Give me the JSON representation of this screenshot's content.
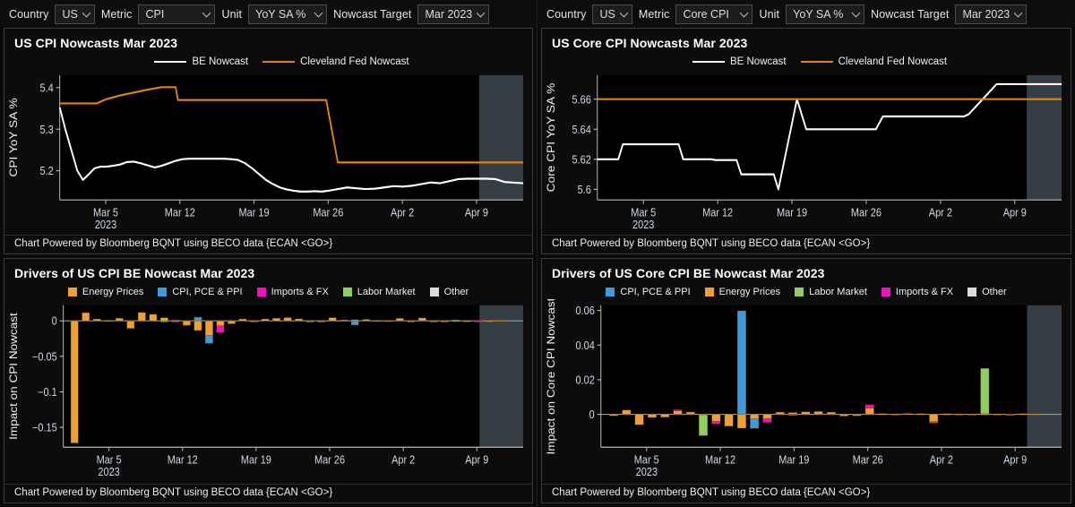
{
  "panels": {
    "topleft": {
      "controls": {
        "country_label": "Country",
        "country_value": "US",
        "metric_label": "Metric",
        "metric_value": "CPI",
        "unit_label": "Unit",
        "unit_value": "YoY SA %",
        "target_label": "Nowcast Target",
        "target_value": "Mar 2023"
      },
      "title": "US CPI Nowcasts Mar 2023",
      "footer": "Chart Powered by Bloomberg BQNT using BECO data {ECAN <GO>}"
    },
    "topright": {
      "controls": {
        "country_label": "Country",
        "country_value": "US",
        "metric_label": "Metric",
        "metric_value": "Core CPI",
        "unit_label": "Unit",
        "unit_value": "YoY SA %",
        "target_label": "Nowcast Target",
        "target_value": "Mar 2023"
      },
      "title": "US Core CPI Nowcasts Mar 2023",
      "footer": "Chart Powered by Bloomberg BQNT using BECO data {ECAN <GO>}"
    },
    "botleft": {
      "title": "Drivers of US CPI BE Nowcast Mar 2023",
      "footer": "Chart Powered by Bloomberg BQNT using BECO data {ECAN <GO>}"
    },
    "botright": {
      "title": "Drivers of US Core CPI BE Nowcast Mar 2023",
      "footer": "Chart Powered by Bloomberg BQNT using BECO data {ECAN <GO>}"
    }
  },
  "colors": {
    "be_nowcast": "#ffffff",
    "cleveland": "#e08214",
    "energy": "#f0a030",
    "cpi_pce_ppi": "#3d9ae0",
    "imports_fx": "#f012be",
    "labor_market": "#8ed060",
    "other": "#dcdcdc",
    "shade": "#3a434a",
    "panel_border": "#3b3b3b"
  },
  "chart_data": [
    {
      "id": "us-cpi-nowcasts",
      "type": "line",
      "title": "US CPI Nowcasts Mar 2023",
      "xlabel": "",
      "ylabel": "CPI YoY SA %",
      "ylim": [
        5.13,
        5.43
      ],
      "yticks": [
        5.2,
        5.3,
        5.4
      ],
      "ytick_labels": [
        "5.2",
        "5.3",
        "5.4"
      ],
      "xticks": [
        "Mar 5",
        "Mar 12",
        "Mar 19",
        "Mar 26",
        "Apr 2",
        "Apr 9"
      ],
      "x_sublabel": "2023",
      "legend": [
        "BE Nowcast",
        "Cleveland Fed Nowcast"
      ],
      "legend_position": "top-center",
      "grid": false,
      "shaded_region_from": 0.905,
      "series": [
        {
          "name": "BE Nowcast",
          "color": "#ffffff",
          "x": [
            0,
            0.012,
            0.025,
            0.038,
            0.05,
            0.063,
            0.075,
            0.088,
            0.1,
            0.115,
            0.13,
            0.145,
            0.16,
            0.175,
            0.19,
            0.205,
            0.22,
            0.235,
            0.25,
            0.265,
            0.28,
            0.295,
            0.31,
            0.325,
            0.34,
            0.355,
            0.37,
            0.385,
            0.4,
            0.415,
            0.43,
            0.445,
            0.46,
            0.475,
            0.49,
            0.505,
            0.52,
            0.535,
            0.55,
            0.565,
            0.58,
            0.6,
            0.62,
            0.64,
            0.66,
            0.68,
            0.7,
            0.72,
            0.74,
            0.76,
            0.78,
            0.8,
            0.82,
            0.84,
            0.86,
            0.88,
            0.9,
            0.92,
            0.94,
            0.96,
            1.0
          ],
          "values": [
            5.352,
            5.3,
            5.25,
            5.2,
            5.178,
            5.192,
            5.206,
            5.21,
            5.21,
            5.212,
            5.215,
            5.221,
            5.222,
            5.218,
            5.213,
            5.208,
            5.212,
            5.218,
            5.224,
            5.228,
            5.229,
            5.229,
            5.229,
            5.229,
            5.229,
            5.229,
            5.228,
            5.226,
            5.218,
            5.206,
            5.192,
            5.178,
            5.168,
            5.16,
            5.155,
            5.152,
            5.15,
            5.15,
            5.151,
            5.15,
            5.152,
            5.156,
            5.16,
            5.158,
            5.156,
            5.157,
            5.16,
            5.163,
            5.162,
            5.164,
            5.168,
            5.172,
            5.17,
            5.175,
            5.18,
            5.181,
            5.181,
            5.181,
            5.18,
            5.173,
            5.17
          ]
        },
        {
          "name": "Cleveland Fed Nowcast",
          "color": "#e08214",
          "x": [
            0,
            0.04,
            0.08,
            0.1,
            0.13,
            0.16,
            0.19,
            0.22,
            0.25,
            0.255,
            0.3,
            0.4,
            0.5,
            0.55,
            0.575,
            0.6,
            0.7,
            0.8,
            0.9,
            1.0
          ],
          "values": [
            5.362,
            5.362,
            5.362,
            5.372,
            5.381,
            5.388,
            5.395,
            5.401,
            5.401,
            5.37,
            5.37,
            5.37,
            5.37,
            5.37,
            5.37,
            5.22,
            5.22,
            5.22,
            5.22,
            5.22
          ]
        }
      ]
    },
    {
      "id": "us-core-cpi-nowcasts",
      "type": "line",
      "title": "US Core CPI Nowcasts Mar 2023",
      "xlabel": "",
      "ylabel": "Core CPI YoY SA %",
      "ylim": [
        5.593,
        5.676
      ],
      "yticks": [
        5.6,
        5.62,
        5.64,
        5.66
      ],
      "ytick_labels": [
        "5.6",
        "5.62",
        "5.64",
        "5.66"
      ],
      "xticks": [
        "Mar 5",
        "Mar 12",
        "Mar 19",
        "Mar 26",
        "Apr 2",
        "Apr 9"
      ],
      "x_sublabel": "2023",
      "legend": [
        "BE Nowcast",
        "Cleveland Fed Nowcast"
      ],
      "legend_position": "top-center",
      "grid": false,
      "shaded_region_from": 0.925,
      "series": [
        {
          "name": "BE Nowcast",
          "color": "#ffffff",
          "x": [
            0,
            0.045,
            0.055,
            0.09,
            0.175,
            0.185,
            0.245,
            0.255,
            0.3,
            0.31,
            0.38,
            0.39,
            0.43,
            0.45,
            0.49,
            0.53,
            0.6,
            0.615,
            0.7,
            0.79,
            0.8,
            0.86,
            0.875,
            1.0
          ],
          "values": [
            5.62,
            5.62,
            5.63,
            5.63,
            5.63,
            5.62,
            5.62,
            5.6195,
            5.6195,
            5.61,
            5.61,
            5.6,
            5.66,
            5.64,
            5.64,
            5.64,
            5.64,
            5.6485,
            5.6485,
            5.6485,
            5.65,
            5.67,
            5.67,
            5.67
          ]
        },
        {
          "name": "Cleveland Fed Nowcast",
          "color": "#e08214",
          "x": [
            0,
            1.0
          ],
          "values": [
            5.66,
            5.66
          ]
        }
      ]
    },
    {
      "id": "drivers-us-cpi",
      "type": "bar",
      "stacked": true,
      "title": "Drivers of US CPI BE Nowcast Mar 2023",
      "xlabel": "",
      "ylabel": "Impact on CPI Nowcast",
      "ylim": [
        -0.178,
        0.022
      ],
      "yticks": [
        0,
        -0.05,
        -0.1,
        -0.15
      ],
      "ytick_labels": [
        "0",
        "−0.05",
        "−0.1",
        "−0.15"
      ],
      "xticks": [
        "Mar 5",
        "Mar 12",
        "Mar 19",
        "Mar 26",
        "Apr 2",
        "Apr 9"
      ],
      "x_sublabel": "2023",
      "legend": [
        "Energy Prices",
        "CPI, PCE & PPI",
        "Imports & FX",
        "Labor Market",
        "Other"
      ],
      "legend_position": "top-center",
      "grid": false,
      "shaded_region_from": 0.905,
      "n_bars": 48,
      "series": [
        {
          "name": "Energy Prices",
          "color": "#f0a030",
          "values": [
            -0.172,
            0.0115,
            0.0025,
            0.0008,
            0.0036,
            -0.0105,
            0.0118,
            0.0092,
            0.0045,
            -0.0008,
            -0.0062,
            -0.0135,
            -0.0205,
            -0.0068,
            -0.004,
            0.0026,
            -0.0013,
            0.0026,
            0.0036,
            0.0046,
            0.0028,
            -0.0013,
            -0.0011,
            0.0045,
            0.0013,
            0.0016,
            0.002,
            0.0008,
            0.0007,
            0.0035,
            -0.001,
            0.0041,
            -0.0005,
            -0.0006,
            0.0005,
            0.0003,
            0.0002,
            0.0004,
            0.0008
          ]
        },
        {
          "name": "CPI, PCE & PPI",
          "color": "#3d9ae0",
          "values": [
            0,
            0,
            0,
            0,
            0,
            0,
            0,
            0,
            0,
            0,
            0,
            0.0052,
            -0.011,
            0,
            0,
            0,
            0,
            0,
            0,
            0,
            0,
            0,
            0,
            0,
            0,
            -0.0058,
            0,
            0,
            0,
            0,
            0,
            0,
            0,
            0,
            0,
            0,
            0,
            0,
            0
          ]
        },
        {
          "name": "Imports & FX",
          "color": "#f012be",
          "values": [
            0,
            0,
            0,
            0,
            0,
            0,
            0,
            0,
            0,
            0.0012,
            0,
            0,
            0,
            -0.0095,
            0,
            0,
            0,
            0,
            0,
            0,
            0,
            0,
            0,
            0,
            0,
            0,
            0,
            0,
            0,
            0,
            0,
            0,
            0,
            0,
            0,
            0,
            -0.0014,
            0,
            0
          ]
        },
        {
          "name": "Labor Market",
          "color": "#8ed060",
          "values": [
            0,
            0,
            0,
            0,
            0,
            0,
            0,
            0,
            -0.0009,
            0,
            0,
            0,
            0,
            0,
            0,
            0,
            0,
            0,
            0,
            0,
            0,
            0,
            0,
            0,
            0,
            0,
            0,
            0,
            0,
            0,
            0,
            0,
            0,
            0,
            0.0006,
            0,
            0,
            0,
            0
          ]
        },
        {
          "name": "Other",
          "color": "#dcdcdc",
          "values": [
            0,
            0,
            0,
            0,
            0,
            0,
            0,
            0,
            0,
            0,
            0,
            0,
            0,
            0,
            0,
            0,
            0,
            0,
            0,
            0,
            0,
            0,
            0,
            0,
            0,
            0,
            0,
            0,
            0,
            0,
            0,
            0,
            0,
            0,
            0,
            0,
            0,
            0,
            0
          ]
        }
      ]
    },
    {
      "id": "drivers-us-core-cpi",
      "type": "bar",
      "stacked": true,
      "title": "Drivers of US Core CPI BE Nowcast Mar 2023",
      "xlabel": "",
      "ylabel": "Impact on Core CPI Nowcast",
      "ylim": [
        -0.019,
        0.063
      ],
      "yticks": [
        0,
        0.02,
        0.04,
        0.06
      ],
      "ytick_labels": [
        "0",
        "0.02",
        "0.04",
        "0.06"
      ],
      "xticks": [
        "Mar 5",
        "Mar 12",
        "Mar 19",
        "Mar 26",
        "Apr 2",
        "Apr 9"
      ],
      "x_sublabel": "2023",
      "legend": [
        "CPI, PCE & PPI",
        "Energy Prices",
        "Labor Market",
        "Imports & FX",
        "Other"
      ],
      "legend_position": "top-center",
      "grid": false,
      "shaded_region_from": 0.925,
      "n_bars": 42,
      "series": [
        {
          "name": "Energy Prices",
          "color": "#f0a030",
          "values": [
            -0.0008,
            0.0024,
            -0.006,
            -0.0018,
            -0.0016,
            0.002,
            0.0013,
            -0.0003,
            -0.004,
            -0.0068,
            -0.008,
            -0.0026,
            -0.0024,
            0.0012,
            0.001,
            0.0014,
            0.0016,
            0.0012,
            -0.001,
            -0.0008,
            0.0035,
            0.0004,
            0.0002,
            0.0005,
            0.0004,
            -0.0042,
            0.0003,
            0.0002,
            0.0002,
            0.0003,
            0.0002,
            0.0001,
            0.0004,
            0.0002
          ]
        },
        {
          "name": "CPI, PCE & PPI",
          "color": "#3d9ae0",
          "values": [
            0,
            0,
            0,
            0,
            0,
            0,
            0,
            0,
            0,
            0,
            0.0598,
            -0.0055,
            0,
            0,
            0,
            0,
            0,
            0,
            0,
            0,
            0,
            0,
            0,
            0,
            0,
            0,
            0,
            0,
            0,
            0,
            0,
            0,
            0,
            0
          ]
        },
        {
          "name": "Imports & FX",
          "color": "#f012be",
          "values": [
            0,
            0,
            0,
            0,
            0,
            0.0006,
            0,
            0,
            -0.0015,
            0,
            0,
            0,
            -0.0022,
            0,
            -0.0007,
            0,
            0,
            0,
            0,
            0,
            0.002,
            0,
            0,
            0,
            0,
            -0.0009,
            0,
            0,
            0,
            0,
            0,
            -0.0003,
            0,
            0
          ]
        },
        {
          "name": "Labor Market",
          "color": "#8ed060",
          "values": [
            0,
            0,
            0,
            0,
            0,
            0,
            0,
            -0.012,
            0,
            0,
            0,
            0,
            0,
            0,
            0,
            0,
            0,
            0,
            0,
            0,
            0,
            0,
            0,
            0,
            0,
            0,
            0,
            0,
            0,
            0.0262,
            0,
            0,
            0,
            0
          ]
        },
        {
          "name": "Other",
          "color": "#dcdcdc",
          "values": [
            0,
            0,
            0,
            0,
            0,
            0,
            0,
            0,
            0,
            0,
            0,
            0,
            0,
            0,
            0,
            0,
            0,
            0,
            0,
            0,
            0,
            0,
            0,
            0,
            0,
            0,
            0,
            0,
            0,
            0,
            0,
            0,
            0,
            0
          ]
        }
      ]
    }
  ]
}
